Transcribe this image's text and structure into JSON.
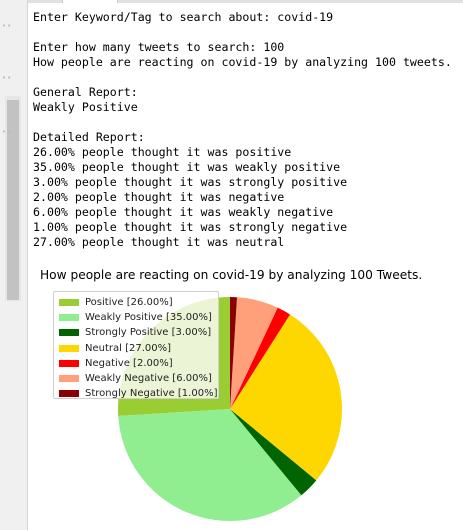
{
  "console": {
    "lines": [
      "Enter Keyword/Tag to search about: covid-19",
      "",
      "Enter how many tweets to search: 100",
      "How people are reacting on covid-19 by analyzing 100 tweets.",
      "",
      "General Report:",
      "Weakly Positive",
      "",
      "Detailed Report:",
      "26.00% people thought it was positive",
      "35.00% people thought it was weakly positive",
      "3.00% people thought it was strongly positive",
      "2.00% people thought it was negative",
      "6.00% people thought it was weakly negative",
      "1.00% people thought it was strongly negative",
      "27.00% people thought it was neutral"
    ]
  },
  "chart_data": {
    "type": "pie",
    "title": "How people are reacting on covid-19 by analyzing 100 Tweets.",
    "slices": [
      {
        "label": "Positive [26.00%]",
        "value": 26,
        "color": "#9acd32"
      },
      {
        "label": "Weakly Positive [35.00%]",
        "value": 35,
        "color": "#90ee90"
      },
      {
        "label": "Strongly Positive [3.00%]",
        "value": 3,
        "color": "#006400"
      },
      {
        "label": "Neutral [27.00%]",
        "value": 27,
        "color": "#ffd700"
      },
      {
        "label": "Negative [2.00%]",
        "value": 2,
        "color": "#ff0000"
      },
      {
        "label": "Weakly Negative [6.00%]",
        "value": 6,
        "color": "#ffa07a"
      },
      {
        "label": "Strongly Negative [1.00%]",
        "value": 1,
        "color": "#8b0000"
      }
    ],
    "legend_position": "upper-left",
    "start_angle_deg": 90,
    "direction": "counterclockwise"
  }
}
